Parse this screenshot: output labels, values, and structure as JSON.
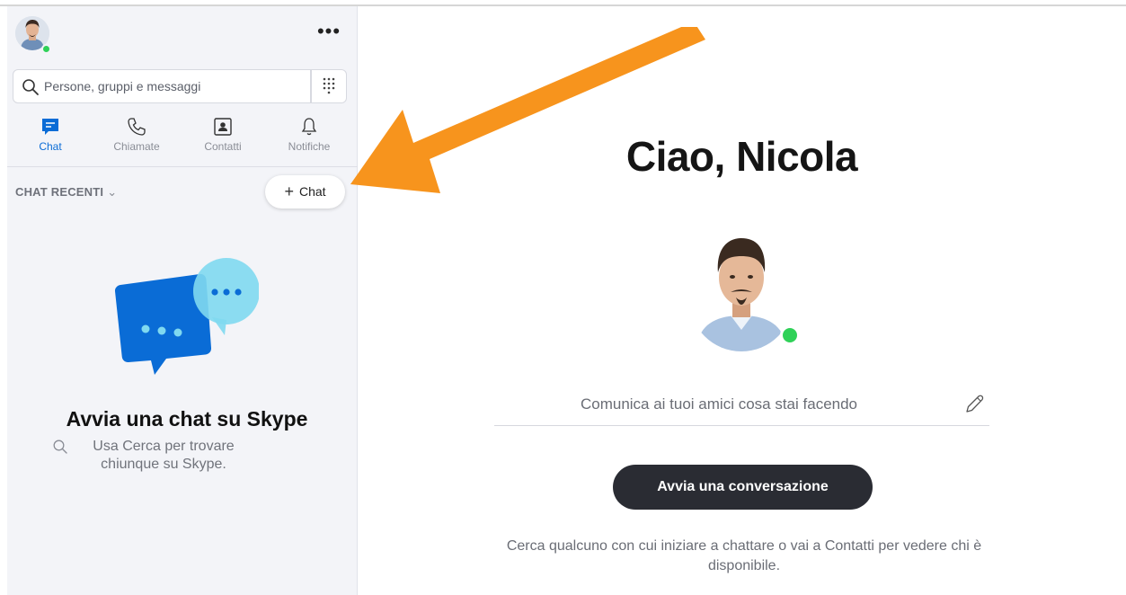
{
  "sidebar": {
    "search": {
      "placeholder": "Persone, gruppi e messaggi"
    },
    "more_label": "•••",
    "tabs": [
      {
        "label": "Chat",
        "icon": "chat-icon",
        "active": true
      },
      {
        "label": "Chiamate",
        "icon": "phone-icon",
        "active": false
      },
      {
        "label": "Contatti",
        "icon": "contacts-icon",
        "active": false
      },
      {
        "label": "Notifiche",
        "icon": "bell-icon",
        "active": false
      }
    ],
    "recent_label": "CHAT RECENTI",
    "new_chat_label": "Chat",
    "empty": {
      "title": "Avvia una chat su Skype",
      "subtitle": "Usa Cerca per trovare chiunque su Skype."
    }
  },
  "main": {
    "greeting": "Ciao, Nicola",
    "mood_placeholder": "Comunica ai tuoi amici cosa stai facendo",
    "start_button": "Avvia una conversazione",
    "hint": "Cerca qualcuno con cui iniziare a chattare o vai a Contatti per vedere chi è disponibile."
  },
  "colors": {
    "accent": "#0a6cd6",
    "presence": "#2fd158",
    "arrow": "#f7941d",
    "dark_button": "#2a2c33",
    "sidebar_bg": "#f3f4f8"
  }
}
